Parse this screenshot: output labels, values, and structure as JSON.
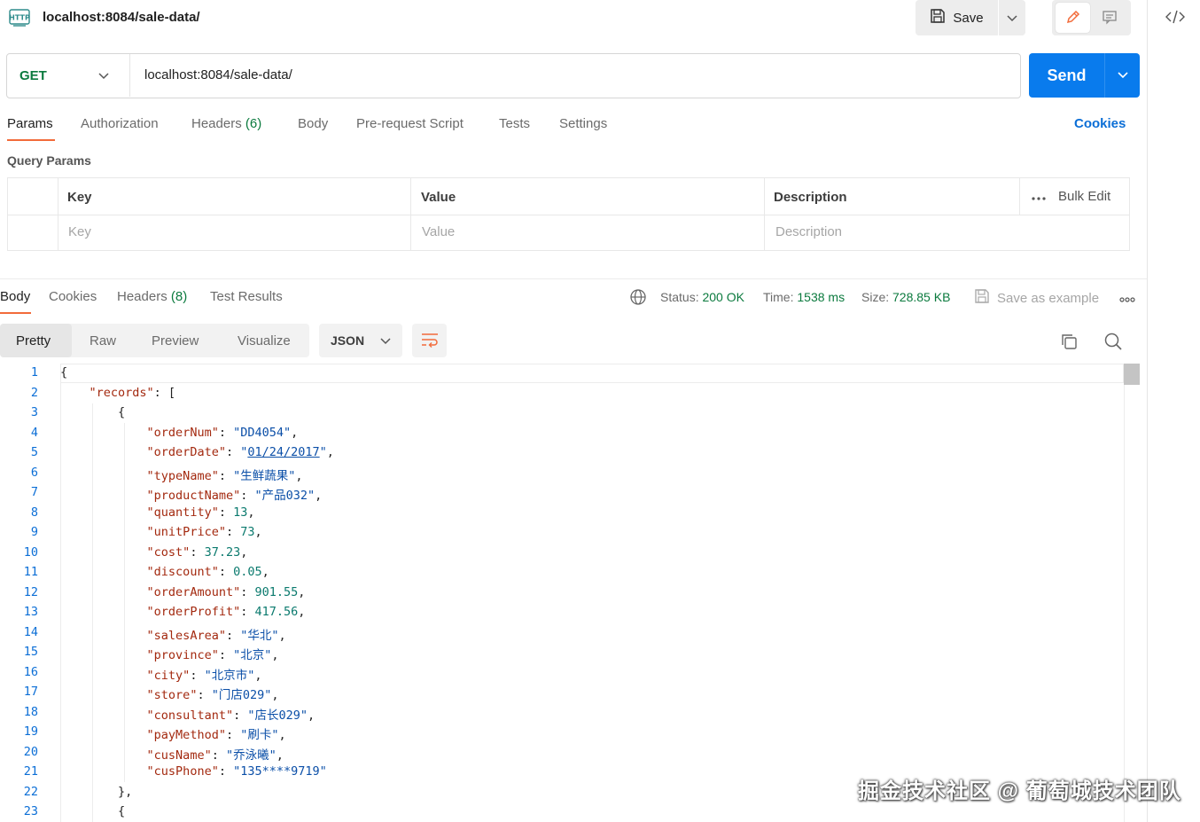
{
  "top": {
    "title": "localhost:8084/sale-data/",
    "save_label": "Save"
  },
  "request": {
    "method": "GET",
    "url": "localhost:8084/sale-data/",
    "send_label": "Send"
  },
  "request_tabs": [
    {
      "label": "Params",
      "active": true
    },
    {
      "label": "Authorization"
    },
    {
      "label": "Headers",
      "count": "(6)"
    },
    {
      "label": "Body"
    },
    {
      "label": "Pre-request Script"
    },
    {
      "label": "Tests"
    },
    {
      "label": "Settings"
    }
  ],
  "cookies_label": "Cookies",
  "query_params": {
    "title": "Query Params",
    "headers": {
      "key": "Key",
      "value": "Value",
      "description": "Description"
    },
    "bulk_edit": "Bulk Edit",
    "placeholders": {
      "key": "Key",
      "value": "Value",
      "description": "Description"
    }
  },
  "response_tabs": [
    {
      "label": "Body",
      "active": true
    },
    {
      "label": "Cookies"
    },
    {
      "label": "Headers",
      "count": "(8)"
    },
    {
      "label": "Test Results"
    }
  ],
  "status": {
    "status_label": "Status:",
    "status_value": "200 OK",
    "time_label": "Time:",
    "time_value": "1538 ms",
    "size_label": "Size:",
    "size_value": "728.85 KB",
    "save_example": "Save as example"
  },
  "view_tabs": [
    {
      "label": "Pretty",
      "active": true
    },
    {
      "label": "Raw"
    },
    {
      "label": "Preview"
    },
    {
      "label": "Visualize"
    }
  ],
  "format": "JSON",
  "code": {
    "lines": [
      "{",
      "    \"records\": [",
      "        {",
      "            \"orderNum\": \"DD4054\",",
      "            \"orderDate\": \"01/24/2017\",",
      "            \"typeName\": \"生鲜蔬果\",",
      "            \"productName\": \"产品032\",",
      "            \"quantity\": 13,",
      "            \"unitPrice\": 73,",
      "            \"cost\": 37.23,",
      "            \"discount\": 0.05,",
      "            \"orderAmount\": 901.55,",
      "            \"orderProfit\": 417.56,",
      "            \"salesArea\": \"华北\",",
      "            \"province\": \"北京\",",
      "            \"city\": \"北京市\",",
      "            \"store\": \"门店029\",",
      "            \"consultant\": \"店长029\",",
      "            \"payMethod\": \"刷卡\",",
      "            \"cusName\": \"乔泳曦\",",
      "            \"cusPhone\": \"135****9719\"",
      "        },",
      "        {"
    ]
  },
  "watermark": "掘金技术社区 @ 葡萄城技术团队",
  "colors": {
    "accent": "#097bed",
    "tab_underline": "#f26b3a",
    "ok": "#0b7a3e"
  }
}
